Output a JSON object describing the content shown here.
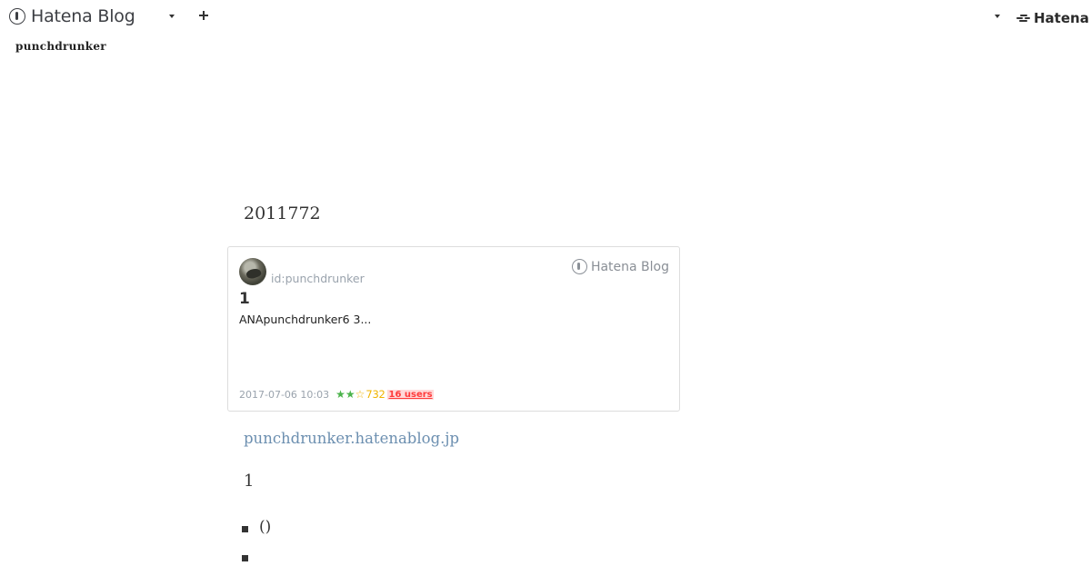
{
  "header": {
    "logo_text": "Hatena Blog",
    "brand_text": "Hatena"
  },
  "blog": {
    "title": "punchdrunker"
  },
  "entry": {
    "heading": "2011772"
  },
  "card": {
    "author": "id:punchdrunker",
    "brand": "Hatena Blog",
    "title": "1",
    "description": "ANApunchdrunker6 3...",
    "date": "2017-07-06 10:03",
    "star_count": "732",
    "bookmark_users": "16 users",
    "colors": {
      "star_green": "#4bb34b",
      "star_yellow": "#f0b400",
      "bookmark": "#ff3b3b"
    }
  },
  "links": {
    "blog_url": "punchdrunker.hatenablog.jp"
  },
  "content": {
    "section_number": "1",
    "bullets": [
      "()",
      ""
    ]
  },
  "icons": [
    "hatena-blog-logo-icon",
    "chevron-down-icon",
    "plus-icon",
    "hatena-logo-icon",
    "star-icon"
  ]
}
